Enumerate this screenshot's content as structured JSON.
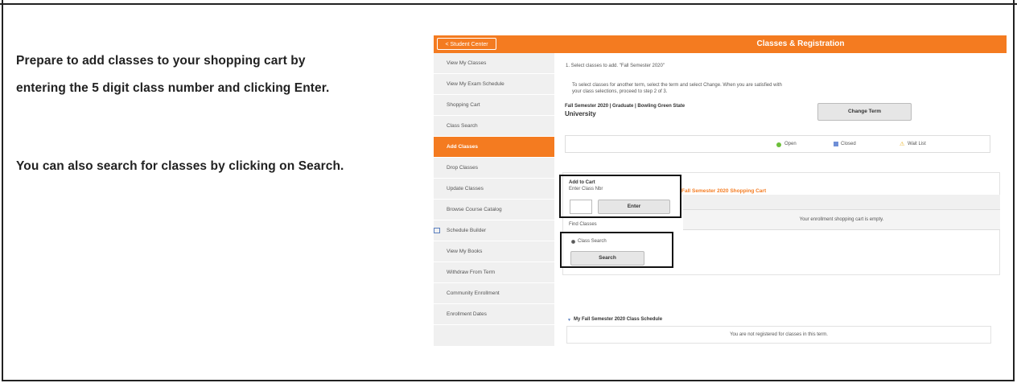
{
  "instructions": {
    "line1": "Prepare to add classes to your shopping cart by",
    "line2": "entering the 5 digit class number and clicking Enter.",
    "line3": "You can also search for classes by clicking on Search."
  },
  "header": {
    "back_label": "< Student Center",
    "title": "Classes & Registration"
  },
  "sidebar": {
    "items": [
      {
        "label": "View My Classes"
      },
      {
        "label": "View My Exam Schedule"
      },
      {
        "label": "Shopping Cart"
      },
      {
        "label": "Class Search"
      },
      {
        "label": "Add Classes"
      },
      {
        "label": "Drop Classes"
      },
      {
        "label": "Update Classes"
      },
      {
        "label": "Browse Course Catalog"
      },
      {
        "label": "Schedule Builder"
      },
      {
        "label": "View My Books"
      },
      {
        "label": "Withdraw From Term"
      },
      {
        "label": "Community Enrollment"
      },
      {
        "label": "Enrollment Dates"
      }
    ],
    "active_index": 4
  },
  "main": {
    "step": "1.  Select classes to add.  \"Fall Semester 2020\"",
    "help1": "To select classes for another term, select the term and select Change.  When you are satisfied with",
    "help2": "your class selections, proceed to step 2 of 3.",
    "term_line1": "Fall Semester 2020 | Graduate | Bowling Green State",
    "term_line2": "University",
    "change_term": "Change Term",
    "legend": {
      "open": "Open",
      "closed": "Closed",
      "wait_list": "Wait List"
    },
    "add_to_cart": "Add to Cart",
    "enter_class_nbr": "Enter Class Nbr",
    "enter_button": "Enter",
    "find_classes": "Find Classes",
    "class_search_radio": "Class Search",
    "search_button": "Search",
    "cart_title": "Fall Semester 2020 Shopping Cart",
    "cart_empty": "Your enrollment shopping cart is empty.",
    "schedule_title": "My Fall Semester 2020 Class Schedule",
    "schedule_empty": "You are not registered for classes in this term."
  },
  "colors": {
    "brand": "#f47b20",
    "open": "#6cbf3a",
    "closed": "#6f8fd6",
    "wait": "#e8b020"
  }
}
